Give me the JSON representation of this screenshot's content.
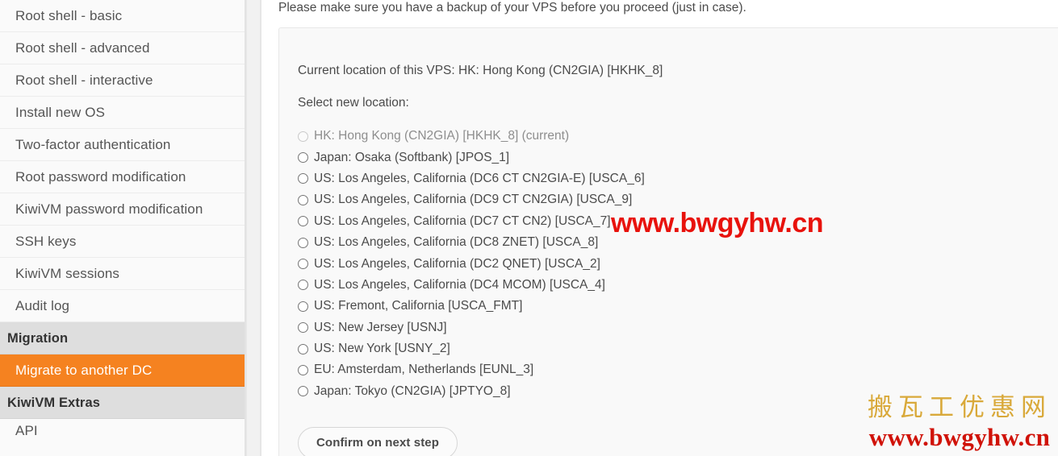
{
  "sidebar": {
    "items": [
      {
        "label": "Root shell - basic",
        "type": "link",
        "active": false
      },
      {
        "label": "Root shell - advanced",
        "type": "link",
        "active": false
      },
      {
        "label": "Root shell - interactive",
        "type": "link",
        "active": false
      },
      {
        "label": "Install new OS",
        "type": "link",
        "active": false
      },
      {
        "label": "Two-factor authentication",
        "type": "link",
        "active": false
      },
      {
        "label": "Root password modification",
        "type": "link",
        "active": false
      },
      {
        "label": "KiwiVM password modification",
        "type": "link",
        "active": false
      },
      {
        "label": "SSH keys",
        "type": "link",
        "active": false
      },
      {
        "label": "KiwiVM sessions",
        "type": "link",
        "active": false
      },
      {
        "label": "Audit log",
        "type": "link",
        "active": false
      },
      {
        "label": "Migration",
        "type": "header",
        "active": false
      },
      {
        "label": "Migrate to another DC",
        "type": "link",
        "active": true
      },
      {
        "label": "KiwiVM Extras",
        "type": "header",
        "active": false
      },
      {
        "label": "API",
        "type": "link",
        "active": false
      }
    ]
  },
  "main": {
    "notice": "Please make sure you have a backup of your VPS before you proceed (just in case).",
    "current_location": "Current location of this VPS: HK: Hong Kong (CN2GIA) [HKHK_8]",
    "select_label": "Select new location:",
    "confirm_button": "Confirm on next step",
    "locations": [
      {
        "label": "HK: Hong Kong (CN2GIA) [HKHK_8] (current)",
        "disabled": true,
        "selected": false
      },
      {
        "label": "Japan: Osaka (Softbank) [JPOS_1]",
        "disabled": false,
        "selected": false
      },
      {
        "label": "US: Los Angeles, California (DC6 CT CN2GIA-E) [USCA_6]",
        "disabled": false,
        "selected": false
      },
      {
        "label": "US: Los Angeles, California (DC9 CT CN2GIA) [USCA_9]",
        "disabled": false,
        "selected": false
      },
      {
        "label": "US: Los Angeles, California (DC7 CT CN2) [USCA_7]",
        "disabled": false,
        "selected": false
      },
      {
        "label": "US: Los Angeles, California (DC8 ZNET) [USCA_8]",
        "disabled": false,
        "selected": false
      },
      {
        "label": "US: Los Angeles, California (DC2 QNET) [USCA_2]",
        "disabled": false,
        "selected": false
      },
      {
        "label": "US: Los Angeles, California (DC4 MCOM) [USCA_4]",
        "disabled": false,
        "selected": false
      },
      {
        "label": "US: Fremont, California [USCA_FMT]",
        "disabled": false,
        "selected": false
      },
      {
        "label": "US: New Jersey [USNJ]",
        "disabled": false,
        "selected": false
      },
      {
        "label": "US: New York [USNY_2]",
        "disabled": false,
        "selected": false
      },
      {
        "label": "EU: Amsterdam, Netherlands [EUNL_3]",
        "disabled": false,
        "selected": false
      },
      {
        "label": "Japan: Tokyo (CN2GIA) [JPTYO_8]",
        "disabled": false,
        "selected": false
      }
    ]
  },
  "watermark": {
    "inline_url": "www.bwgyhw.cn",
    "corner_name": "搬瓦工优惠网",
    "corner_url": "www.bwgyhw.cn"
  },
  "colors": {
    "accent": "#f58220",
    "sidebar_bg": "#fafafa",
    "header_bg": "#dedede",
    "panel_bg": "#f9f9f9",
    "watermark_red": "#d01208",
    "watermark_gold": "#d9a93a"
  }
}
